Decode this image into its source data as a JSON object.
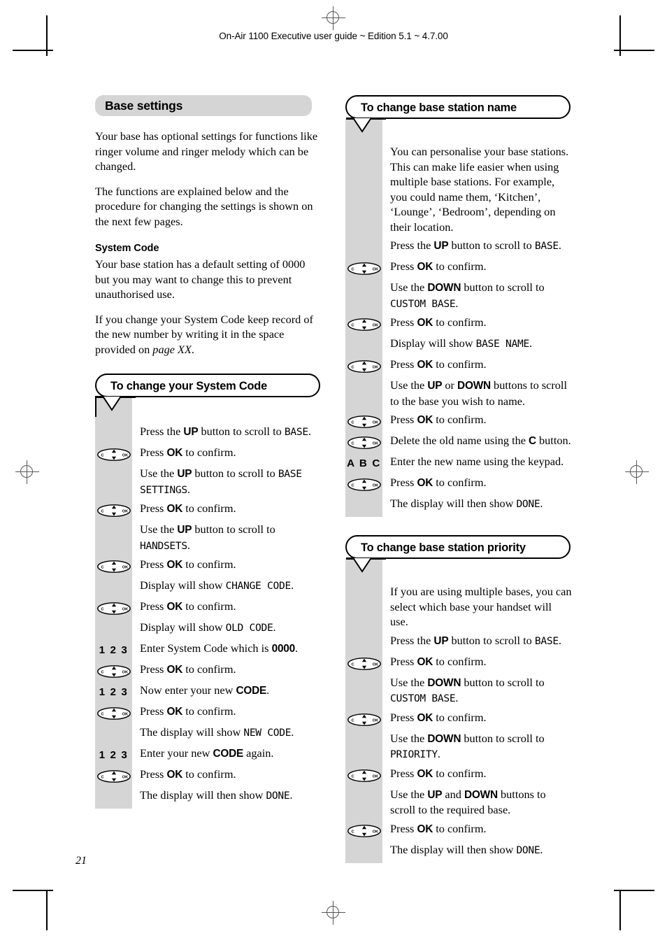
{
  "running_head": "On-Air 1100 Executive user guide ~ Edition 5.1 ~ 4.7.00",
  "folio": "21",
  "icons": {
    "navkey_c": "C",
    "navkey_ok": "OK",
    "digits": "1 2 3",
    "letters": "A B C"
  },
  "left_column": {
    "section_title": "Base settings",
    "intro_paragraphs": [
      "Your base has optional settings for functions like ringer volume and ringer melody which can be changed.",
      "The functions are explained below and the procedure for changing the settings is shown on the next few pages."
    ],
    "subheading": "System Code",
    "subheading_paragraphs": [
      "Your base station has a default setting of 0000 but you may want to change this to prevent unauthorised use."
    ],
    "note_prefix": "If you change your System Code keep record of the new number by writing it in the space provided on ",
    "note_italic": "page XX",
    "note_suffix": ".",
    "callout": {
      "title": "To change your System Code",
      "steps": [
        {
          "icon": "none",
          "pre": "Press the ",
          "bold": "UP",
          "mid": " button to scroll to ",
          "lcd": "BASE",
          "post": "."
        },
        {
          "icon": "navkey",
          "pre": "Press ",
          "bold": "OK",
          "mid": " to confirm.",
          "lcd": "",
          "post": ""
        },
        {
          "icon": "none",
          "pre": "Use the ",
          "bold": "UP",
          "mid": " button to scroll to ",
          "lcd": "BASE SETTINGS",
          "post": "."
        },
        {
          "icon": "navkey",
          "pre": "Press ",
          "bold": "OK",
          "mid": " to confirm.",
          "lcd": "",
          "post": ""
        },
        {
          "icon": "none",
          "pre": "Use the ",
          "bold": "UP",
          "mid": " button to scroll to ",
          "lcd": "HANDSETS",
          "post": "."
        },
        {
          "icon": "navkey",
          "pre": "Press ",
          "bold": "OK",
          "mid": " to confirm.",
          "lcd": "",
          "post": ""
        },
        {
          "icon": "none",
          "pre": "Display will show ",
          "bold": "",
          "mid": "",
          "lcd": "CHANGE CODE",
          "post": "."
        },
        {
          "icon": "navkey",
          "pre": "Press ",
          "bold": "OK",
          "mid": " to confirm.",
          "lcd": "",
          "post": ""
        },
        {
          "icon": "none",
          "pre": "Display will show ",
          "bold": "",
          "mid": "",
          "lcd": "OLD  CODE",
          "post": "."
        },
        {
          "icon": "digits",
          "pre": "Enter System Code which is ",
          "bold": "0000",
          "mid": ".",
          "lcd": "",
          "post": ""
        },
        {
          "icon": "navkey",
          "pre": "Press ",
          "bold": "OK",
          "mid": " to confirm.",
          "lcd": "",
          "post": ""
        },
        {
          "icon": "digits",
          "pre": "Now enter your new ",
          "bold": "CODE",
          "mid": ".",
          "lcd": "",
          "post": ""
        },
        {
          "icon": "navkey",
          "pre": "Press ",
          "bold": "OK",
          "mid": " to confirm.",
          "lcd": "",
          "post": ""
        },
        {
          "icon": "none",
          "pre": "The display will show ",
          "bold": "",
          "mid": "",
          "lcd": "NEW  CODE",
          "post": "."
        },
        {
          "icon": "digits",
          "pre": "Enter your new ",
          "bold": "CODE",
          "mid": " again.",
          "lcd": "",
          "post": ""
        },
        {
          "icon": "navkey",
          "pre": "Press ",
          "bold": "OK",
          "mid": " to confirm.",
          "lcd": "",
          "post": ""
        },
        {
          "icon": "none",
          "pre": "The display will then show ",
          "bold": "",
          "mid": "",
          "lcd": "DONE",
          "post": "."
        }
      ]
    }
  },
  "right_column": {
    "callout_name": {
      "title": "To change base station name",
      "intro": "You can personalise your base stations. This can make life easier when using multiple base stations. For example, you could name them, ‘Kitchen’, ‘Lounge’, ‘Bedroom’, depending on their location.",
      "steps": [
        {
          "icon": "none",
          "pre": "Press the ",
          "bold": "UP",
          "mid": " button to scroll to ",
          "lcd": "BASE",
          "post": "."
        },
        {
          "icon": "navkey",
          "pre": "Press ",
          "bold": "OK",
          "mid": " to confirm.",
          "lcd": "",
          "post": ""
        },
        {
          "icon": "none",
          "pre": "Use the ",
          "bold": "DOWN",
          "mid": " button to scroll to ",
          "lcd": "CUSTOM BASE",
          "post": "."
        },
        {
          "icon": "navkey",
          "pre": "Press ",
          "bold": "OK",
          "mid": " to confirm.",
          "lcd": "",
          "post": ""
        },
        {
          "icon": "none",
          "pre": "Display will show ",
          "bold": "",
          "mid": "",
          "lcd": "BASE NAME",
          "post": "."
        },
        {
          "icon": "navkey",
          "pre": "Press ",
          "bold": "OK",
          "mid": " to confirm.",
          "lcd": "",
          "post": ""
        },
        {
          "icon": "none",
          "pre": "Use the ",
          "bold": "UP",
          "mid": " or ",
          "bold2": "DOWN",
          "mid2": " buttons to scroll to the base you wish to name.",
          "lcd": "",
          "post": ""
        },
        {
          "icon": "navkey",
          "pre": "Press ",
          "bold": "OK",
          "mid": " to confirm.",
          "lcd": "",
          "post": ""
        },
        {
          "icon": "navkey",
          "pre": "Delete the old name using the ",
          "bold": "C",
          "mid": " button.",
          "lcd": "",
          "post": ""
        },
        {
          "icon": "letters",
          "pre": "Enter the new name using the keypad.",
          "bold": "",
          "mid": "",
          "lcd": "",
          "post": ""
        },
        {
          "icon": "navkey",
          "pre": "Press ",
          "bold": "OK",
          "mid": " to confirm.",
          "lcd": "",
          "post": ""
        },
        {
          "icon": "none",
          "pre": "The display will then show ",
          "bold": "",
          "mid": "",
          "lcd": "DONE",
          "post": "."
        }
      ]
    },
    "callout_priority": {
      "title": "To change base station priority",
      "intro": "If you are using multiple bases, you can select which base your handset will use.",
      "steps": [
        {
          "icon": "none",
          "pre": "Press the ",
          "bold": "UP",
          "mid": " button to scroll to ",
          "lcd": "BASE",
          "post": "."
        },
        {
          "icon": "navkey",
          "pre": "Press ",
          "bold": "OK",
          "mid": " to confirm.",
          "lcd": "",
          "post": ""
        },
        {
          "icon": "none",
          "pre": "Use the ",
          "bold": "DOWN",
          "mid": " button to scroll to ",
          "lcd": "CUSTOM BASE",
          "post": "."
        },
        {
          "icon": "navkey",
          "pre": "Press ",
          "bold": "OK",
          "mid": " to confirm.",
          "lcd": "",
          "post": ""
        },
        {
          "icon": "none",
          "pre": "Use the ",
          "bold": "DOWN",
          "mid": " button to scroll to ",
          "lcd": "PRIORITY",
          "post": "."
        },
        {
          "icon": "navkey",
          "pre": "Press ",
          "bold": "OK",
          "mid": " to confirm.",
          "lcd": "",
          "post": ""
        },
        {
          "icon": "none",
          "pre": "Use the ",
          "bold": "UP",
          "mid": " and ",
          "bold2": "DOWN",
          "mid2": " buttons to scroll to the required base.",
          "lcd": "",
          "post": ""
        },
        {
          "icon": "navkey",
          "pre": "Press ",
          "bold": "OK",
          "mid": " to confirm.",
          "lcd": "",
          "post": ""
        },
        {
          "icon": "none",
          "pre": "The display will then show ",
          "bold": "",
          "mid": "",
          "lcd": "DONE",
          "post": "."
        }
      ]
    }
  }
}
